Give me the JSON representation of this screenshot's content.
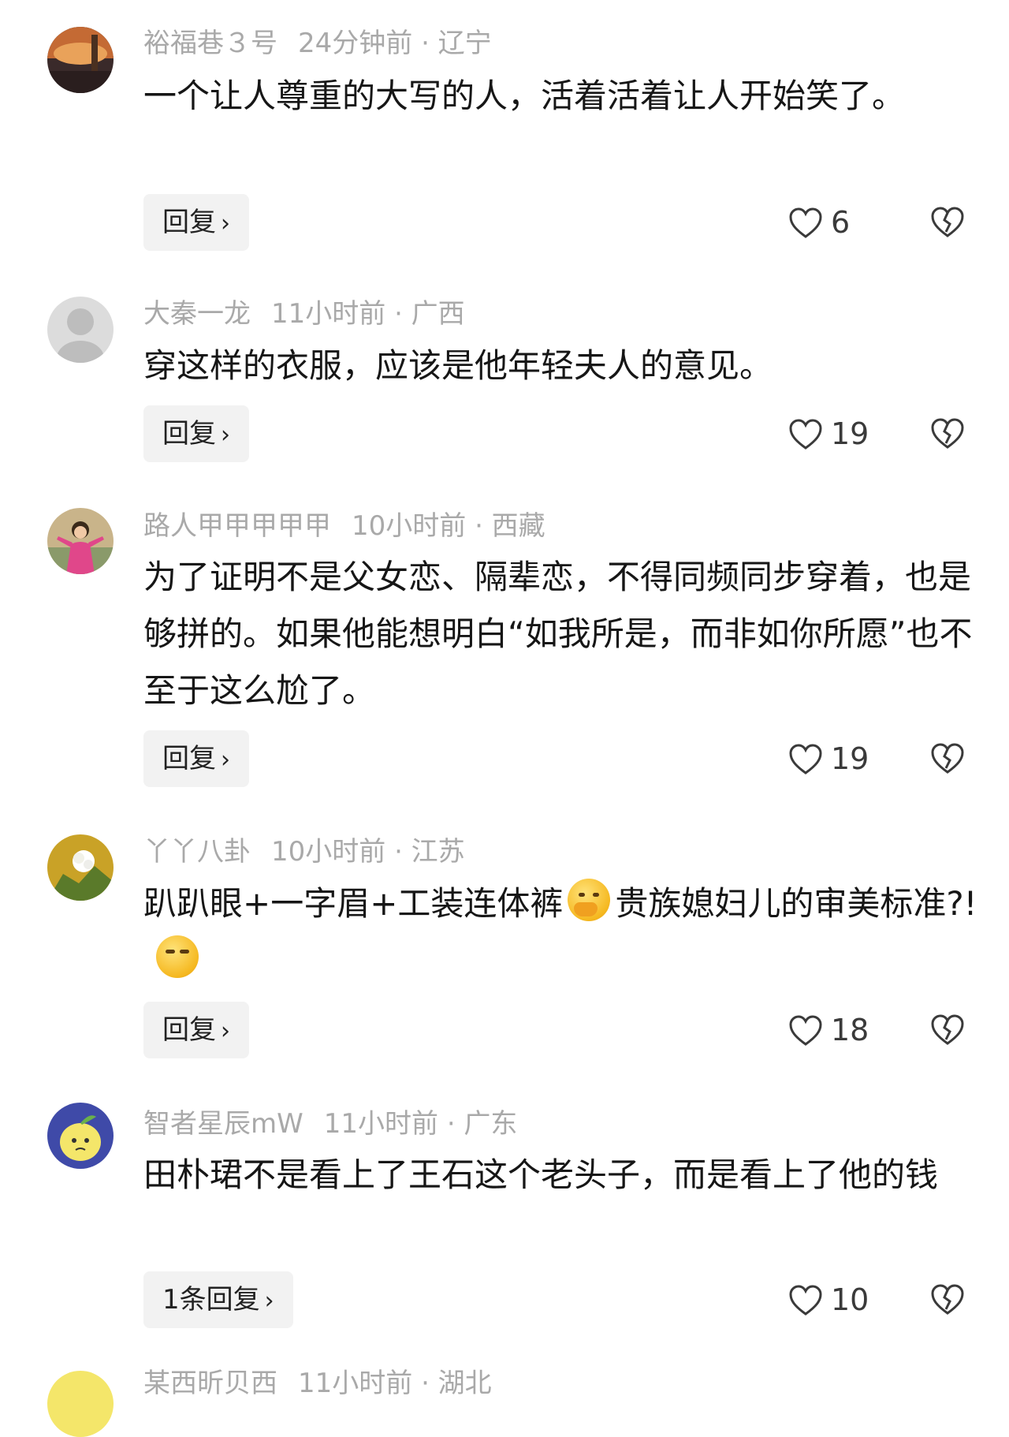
{
  "comments": [
    {
      "user": "裕福巷３号",
      "time": "24分钟前 · 辽宁",
      "text": "一个让人尊重的大写的人，活着活着让人开始笑了。",
      "reply_label": "回复",
      "likes": "6",
      "avatar_colors": [
        "#3a2a2a",
        "#c46a34",
        "#e9a25a"
      ]
    },
    {
      "user": "大秦一龙",
      "time": "11小时前 · 广西",
      "text": "穿这样的衣服，应该是他年轻夫人的意见。",
      "reply_label": "回复",
      "likes": "19",
      "avatar_colors": [
        "#dcdcdc",
        "#bdbdbd",
        "#a8a8a8"
      ]
    },
    {
      "user": "路人甲甲甲甲甲",
      "time": "10小时前 · 西藏",
      "text": "为了证明不是父女恋、隔辈恋，不得同频同步穿着，也是够拼的。如果他能想明白“如我所是，而非如你所愿”也不至于这么尬了。",
      "reply_label": "回复",
      "likes": "19",
      "avatar_colors": [
        "#c9b48a",
        "#e0478a",
        "#7a5a3a"
      ]
    },
    {
      "user": "丫丫八卦",
      "time": "10小时前 · 江苏",
      "text_before": "趴趴眼+一字眉+工装连体裤",
      "text_after": "贵族媳妇儿的审美标准?!",
      "reply_label": "回复",
      "likes": "18",
      "avatar_colors": [
        "#c9a227",
        "#ffffff",
        "#5a7a2a"
      ]
    },
    {
      "user": "智者星辰mW",
      "time": "11小时前 · 广东",
      "text": "田朴珺不是看上了王石这个老头子，而是看上了他的钱",
      "reply_label": "1条回复",
      "likes": "10",
      "avatar_colors": [
        "#3f4aa8",
        "#f4e66a",
        "#6ab04c"
      ]
    },
    {
      "user": "某西昕贝西",
      "time": "11小时前 · 湖北",
      "avatar_colors": [
        "#f4e66a",
        "#f0d040",
        "#e0c030"
      ]
    }
  ]
}
